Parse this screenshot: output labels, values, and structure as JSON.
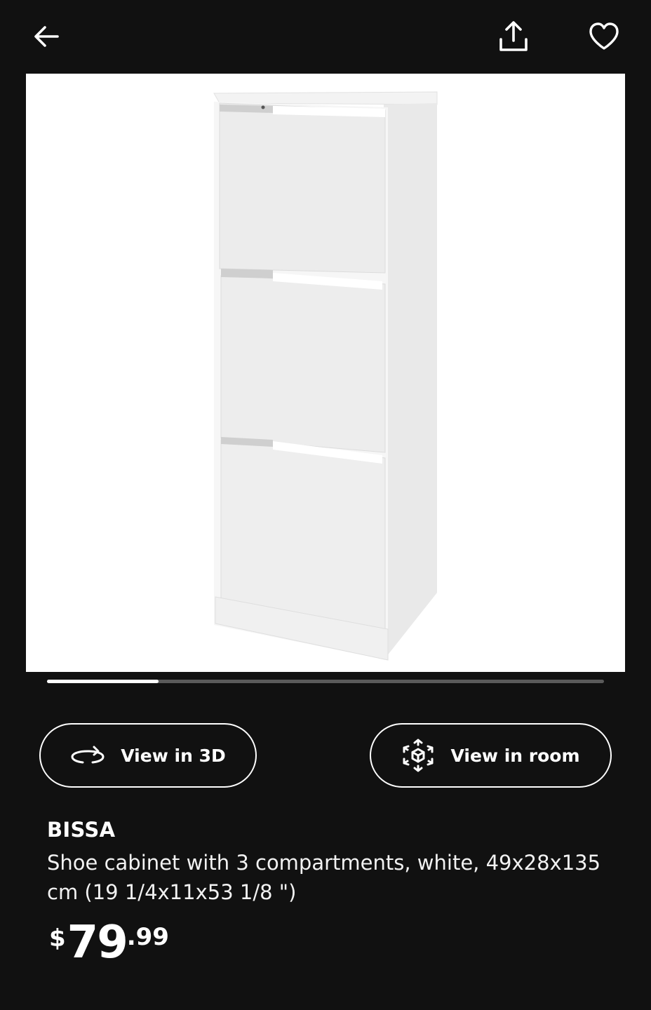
{
  "header": {
    "back_icon": "arrow-left-icon",
    "share_icon": "share-upload-icon",
    "favorite_icon": "heart-outline-icon"
  },
  "gallery": {
    "current_index": 1,
    "progress_fraction": 0.2
  },
  "actions": {
    "view_3d_label": "View in 3D",
    "view_3d_icon": "rotate-3d-icon",
    "view_room_label": "View in room",
    "view_room_icon": "ar-cube-icon"
  },
  "product": {
    "name": "BISSA",
    "description": "Shoe cabinet with 3 compartments, white, 49x28x135 cm (19 1/4x11x53 1/8 \")",
    "price": {
      "currency": "$",
      "integer": "79",
      "decimal": ".99"
    }
  },
  "colors": {
    "background": "#111111",
    "text": "#ffffff",
    "track": "#5a5a5a"
  }
}
